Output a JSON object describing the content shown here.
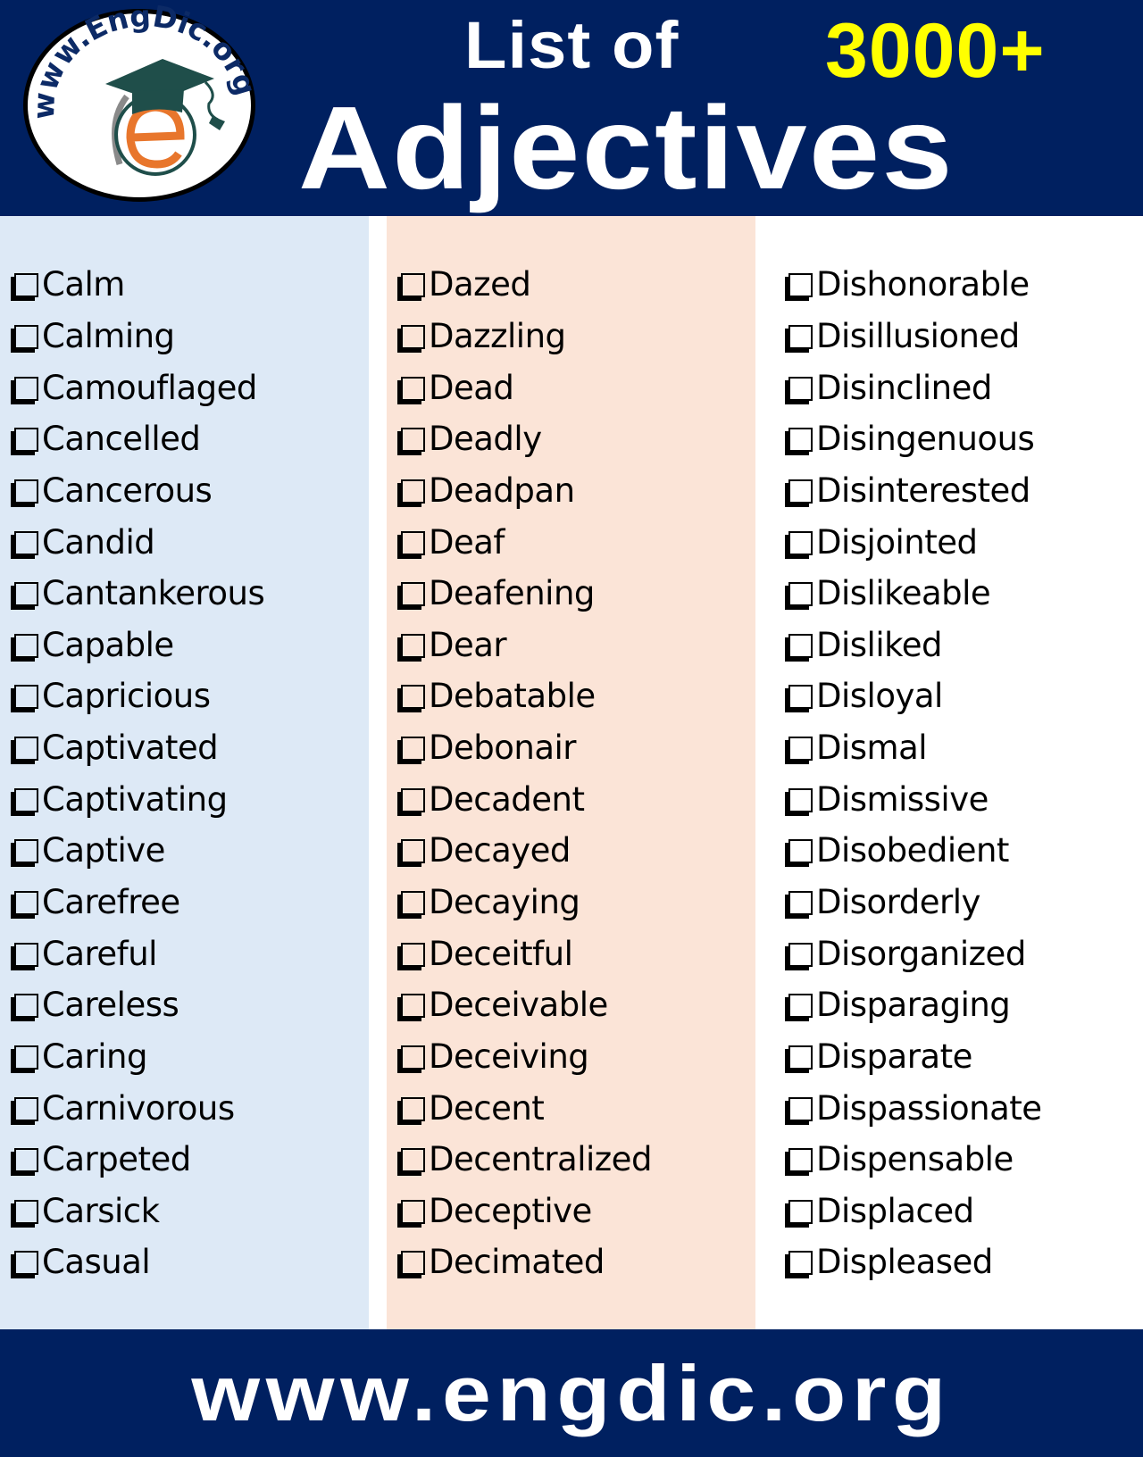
{
  "header": {
    "logo_text": "www.EngDic.org",
    "title_small": "List of",
    "count": "3000+",
    "title_big": "Adjectives"
  },
  "colors": {
    "navy": "#002060",
    "yellow": "#ffff00",
    "column_1_bg": "#dde9f6",
    "column_2_bg": "#fbe4d7",
    "column_3_bg": "#ffffff",
    "logo_orange": "#e8762c",
    "logo_green": "#1f4e4a"
  },
  "columns": [
    {
      "words": [
        "Calm",
        "Calming",
        "Camouflaged",
        "Cancelled",
        "Cancerous",
        "Candid",
        "Cantankerous",
        "Capable",
        "Capricious",
        "Captivated",
        "Captivating",
        "Captive",
        "Carefree",
        "Careful",
        "Careless",
        "Caring",
        "Carnivorous",
        "Carpeted",
        "Carsick",
        "Casual"
      ]
    },
    {
      "words": [
        "Dazed",
        "Dazzling",
        "Dead",
        "Deadly",
        "Deadpan",
        "Deaf",
        "Deafening",
        "Dear",
        "Debatable",
        "Debonair",
        "Decadent",
        "Decayed",
        "Decaying",
        "Deceitful",
        "Deceivable",
        "Deceiving",
        "Decent",
        "Decentralized",
        "Deceptive",
        "Decimated"
      ]
    },
    {
      "words": [
        "Dishonorable",
        "Disillusioned",
        "Disinclined",
        "Disingenuous",
        "Disinterested",
        "Disjointed",
        "Dislikeable",
        "Disliked",
        "Disloyal",
        "Dismal",
        "Dismissive",
        "Disobedient",
        "Disorderly",
        "Disorganized",
        "Disparaging",
        "Disparate",
        "Dispassionate",
        "Dispensable",
        "Displaced",
        "Displeased"
      ]
    }
  ],
  "footer": {
    "url": "www.engdic.org"
  }
}
